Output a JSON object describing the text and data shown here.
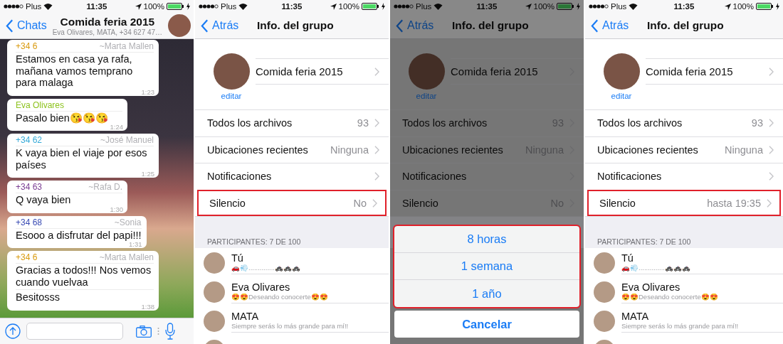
{
  "screens": [
    {
      "kind": "chat",
      "status_bar": {
        "carrier": "Plus",
        "time": "11:35",
        "battery": "100%"
      },
      "nav": {
        "back": "Chats",
        "title": "Comida feria 2015",
        "subtitle": "Eva Olivares, MATA, +34 627 47…"
      },
      "messages": [
        {
          "sender": "+34 6",
          "name": "~Marta Mallen",
          "color": "#d99a0e",
          "paragraphs": [
            "Estamos en casa ya rafa, mañana vamos temprano para malaga"
          ],
          "time": "1:23"
        },
        {
          "sender": "Eva Olivares",
          "color": "#8cc21c",
          "paragraphs": [
            "Pasalo bien😘😘😘"
          ],
          "time": "1:24"
        },
        {
          "sender": "+34 62",
          "name": "~José Manuel",
          "color": "#35a9d8",
          "paragraphs": [
            "K vaya bien el viaje por esos países"
          ],
          "time": "1:25"
        },
        {
          "sender": "+34 63",
          "name": "~Rafa D.",
          "color": "#7a3d94",
          "paragraphs": [
            "Q vaya bien"
          ],
          "time": "1:30"
        },
        {
          "sender": "+34 68",
          "name": "~Sonia",
          "color": "#3a4cb4",
          "paragraphs": [
            "Esooo a disfrutar del papi!!!"
          ],
          "time": "1:31"
        },
        {
          "sender": "+34 6",
          "name": "~Marta Mallen",
          "color": "#d99a0e",
          "paragraphs": [
            "Gracias a todos!!! Nos vemos cuando vuelvaa",
            "Besitosss"
          ],
          "time": "1:38"
        }
      ]
    },
    {
      "kind": "group_info",
      "dimmed": false,
      "status_bar": {
        "carrier": "Plus",
        "time": "11:35",
        "battery": "100%"
      },
      "nav": {
        "back": "Atrás",
        "title": "Info. del grupo"
      },
      "group_name": "Comida feria 2015",
      "edit": "editar",
      "rows": [
        {
          "label": "Todos los archivos",
          "value": "93",
          "highlighted": false
        },
        {
          "label": "Ubicaciones recientes",
          "value": "Ninguna",
          "highlighted": false
        },
        {
          "label": "Notificaciones",
          "highlighted": false
        },
        {
          "label": "Silencio",
          "value": "No",
          "highlighted": true
        }
      ],
      "participants_header": "PARTICIPANTES: 7 DE 100",
      "participants": [
        {
          "name": "Tú",
          "status": "🚗💨..............🚓🚓🚓"
        },
        {
          "name": "Eva Olivares",
          "status": "😍😍Deseando conocerte😍😍"
        },
        {
          "name": "MATA",
          "status": "Siempre serás lo más grande para mí!!"
        }
      ]
    },
    {
      "kind": "group_info",
      "dimmed": true,
      "status_bar": {
        "carrier": "Plus",
        "time": "11:35",
        "battery": "100%"
      },
      "nav": {
        "back": "Atrás",
        "title": "Info. del grupo"
      },
      "group_name": "Comida feria 2015",
      "edit": "editar",
      "rows": [
        {
          "label": "Todos los archivos",
          "value": "93",
          "highlighted": false
        },
        {
          "label": "Ubicaciones recientes",
          "value": "Ninguna",
          "highlighted": false
        },
        {
          "label": "Notificaciones",
          "highlighted": false
        },
        {
          "label": "Silencio",
          "value": "No",
          "highlighted": false
        }
      ],
      "action_sheet": {
        "highlighted": true,
        "options": [
          "8 horas",
          "1 semana",
          "1 año"
        ],
        "cancel": "Cancelar"
      }
    },
    {
      "kind": "group_info",
      "dimmed": false,
      "status_bar": {
        "carrier": "Plus",
        "time": "11:35",
        "battery": "100%"
      },
      "nav": {
        "back": "Atrás",
        "title": "Info. del grupo"
      },
      "group_name": "Comida feria 2015",
      "edit": "editar",
      "rows": [
        {
          "label": "Todos los archivos",
          "value": "93",
          "highlighted": false
        },
        {
          "label": "Ubicaciones recientes",
          "value": "Ninguna",
          "highlighted": false
        },
        {
          "label": "Notificaciones",
          "highlighted": false
        },
        {
          "label": "Silencio",
          "value": "hasta 19:35",
          "highlighted": true
        }
      ],
      "participants_header": "PARTICIPANTES: 7 DE 100",
      "participants": [
        {
          "name": "Tú",
          "status": "🚗💨..............🚓🚓🚓"
        },
        {
          "name": "Eva Olivares",
          "status": "😍😍Deseando conocerte😍😍"
        },
        {
          "name": "MATA",
          "status": "Siempre serás lo más grande para mí!!"
        }
      ]
    }
  ]
}
